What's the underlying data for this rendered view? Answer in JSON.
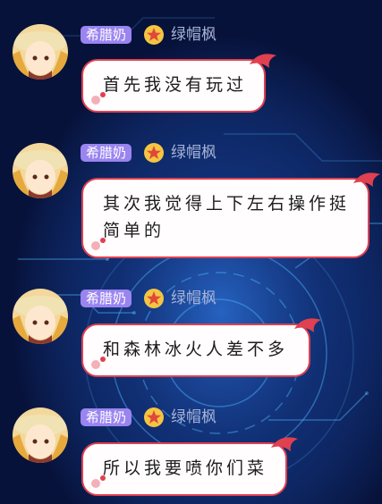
{
  "messages": [
    {
      "badge": "希腊奶",
      "username": "绿帽枫",
      "text": "首先我没有玩过"
    },
    {
      "badge": "希腊奶",
      "username": "绿帽枫",
      "text": "其次我觉得上下左右操作挺简单的"
    },
    {
      "badge": "希腊奶",
      "username": "绿帽枫",
      "text": "和森林冰火人差不多"
    },
    {
      "badge": "希腊奶",
      "username": "绿帽枫",
      "text": "所以我要喷你们菜"
    }
  ],
  "colors": {
    "background": "#0b1a4a",
    "badge": "#9a84f0",
    "bubble_border": "#e04050",
    "username": "#a7b4d8"
  }
}
